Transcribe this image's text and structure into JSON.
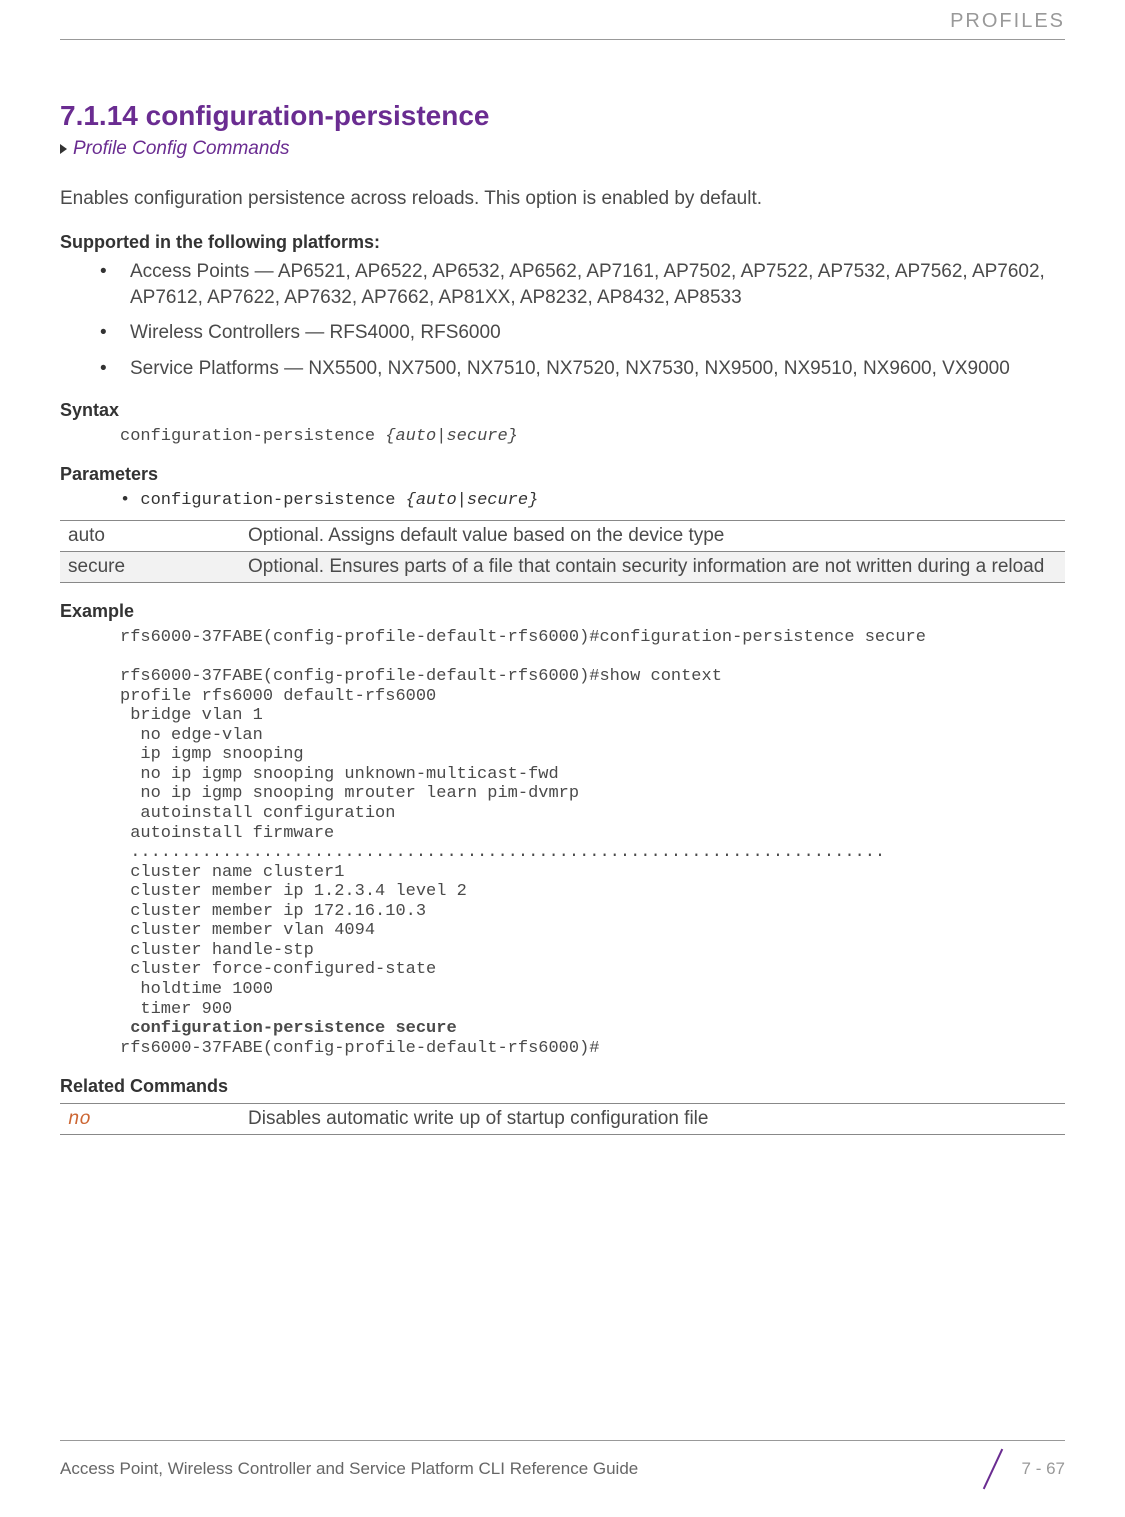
{
  "header": {
    "right_label": "PROFILES"
  },
  "title": "7.1.14 configuration-persistence",
  "breadcrumb": "Profile Config Commands",
  "intro": "Enables configuration persistence across reloads. This option is enabled by default.",
  "supported_head": "Supported in the following platforms:",
  "platforms": [
    "Access Points — AP6521, AP6522, AP6532, AP6562, AP7161, AP7502, AP7522, AP7532, AP7562, AP7602, AP7612, AP7622, AP7632, AP7662, AP81XX, AP8232, AP8432, AP8533",
    "Wireless Controllers — RFS4000, RFS6000",
    "Service Platforms — NX5500, NX7500, NX7510, NX7520, NX7530, NX9500, NX9510, NX9600, VX9000"
  ],
  "syntax_head": "Syntax",
  "syntax": {
    "cmd": "configuration-persistence ",
    "opts": "{auto|secure}"
  },
  "params_head": "Parameters",
  "param_line": {
    "bullet": "• ",
    "cmd": "configuration-persistence ",
    "opts": "{auto|secure}"
  },
  "param_table": [
    {
      "name": "auto",
      "desc": "Optional. Assigns default value based on the device type"
    },
    {
      "name": "secure",
      "desc": "Optional. Ensures parts of a file that contain security information are not written during a reload"
    }
  ],
  "example_head": "Example",
  "example_pre": "rfs6000-37FABE(config-profile-default-rfs6000)#configuration-persistence secure\n\nrfs6000-37FABE(config-profile-default-rfs6000)#show context\nprofile rfs6000 default-rfs6000\n bridge vlan 1\n  no edge-vlan\n  ip igmp snooping\n  no ip igmp snooping unknown-multicast-fwd\n  no ip igmp snooping mrouter learn pim-dvmrp\n  autoinstall configuration\n autoinstall firmware\n ..........................................................................\n cluster name cluster1\n cluster member ip 1.2.3.4 level 2\n cluster member ip 172.16.10.3\n cluster member vlan 4094\n cluster handle-stp\n cluster force-configured-state\n  holdtime 1000\n  timer 900",
  "example_bold": " configuration-persistence secure",
  "example_post": "rfs6000-37FABE(config-profile-default-rfs6000)#",
  "related_head": "Related Commands",
  "related_table": [
    {
      "cmd": "no",
      "desc": "Disables automatic write up of startup configuration file"
    }
  ],
  "footer": {
    "left": "Access Point, Wireless Controller and Service Platform CLI Reference Guide",
    "page": "7 - 67"
  }
}
